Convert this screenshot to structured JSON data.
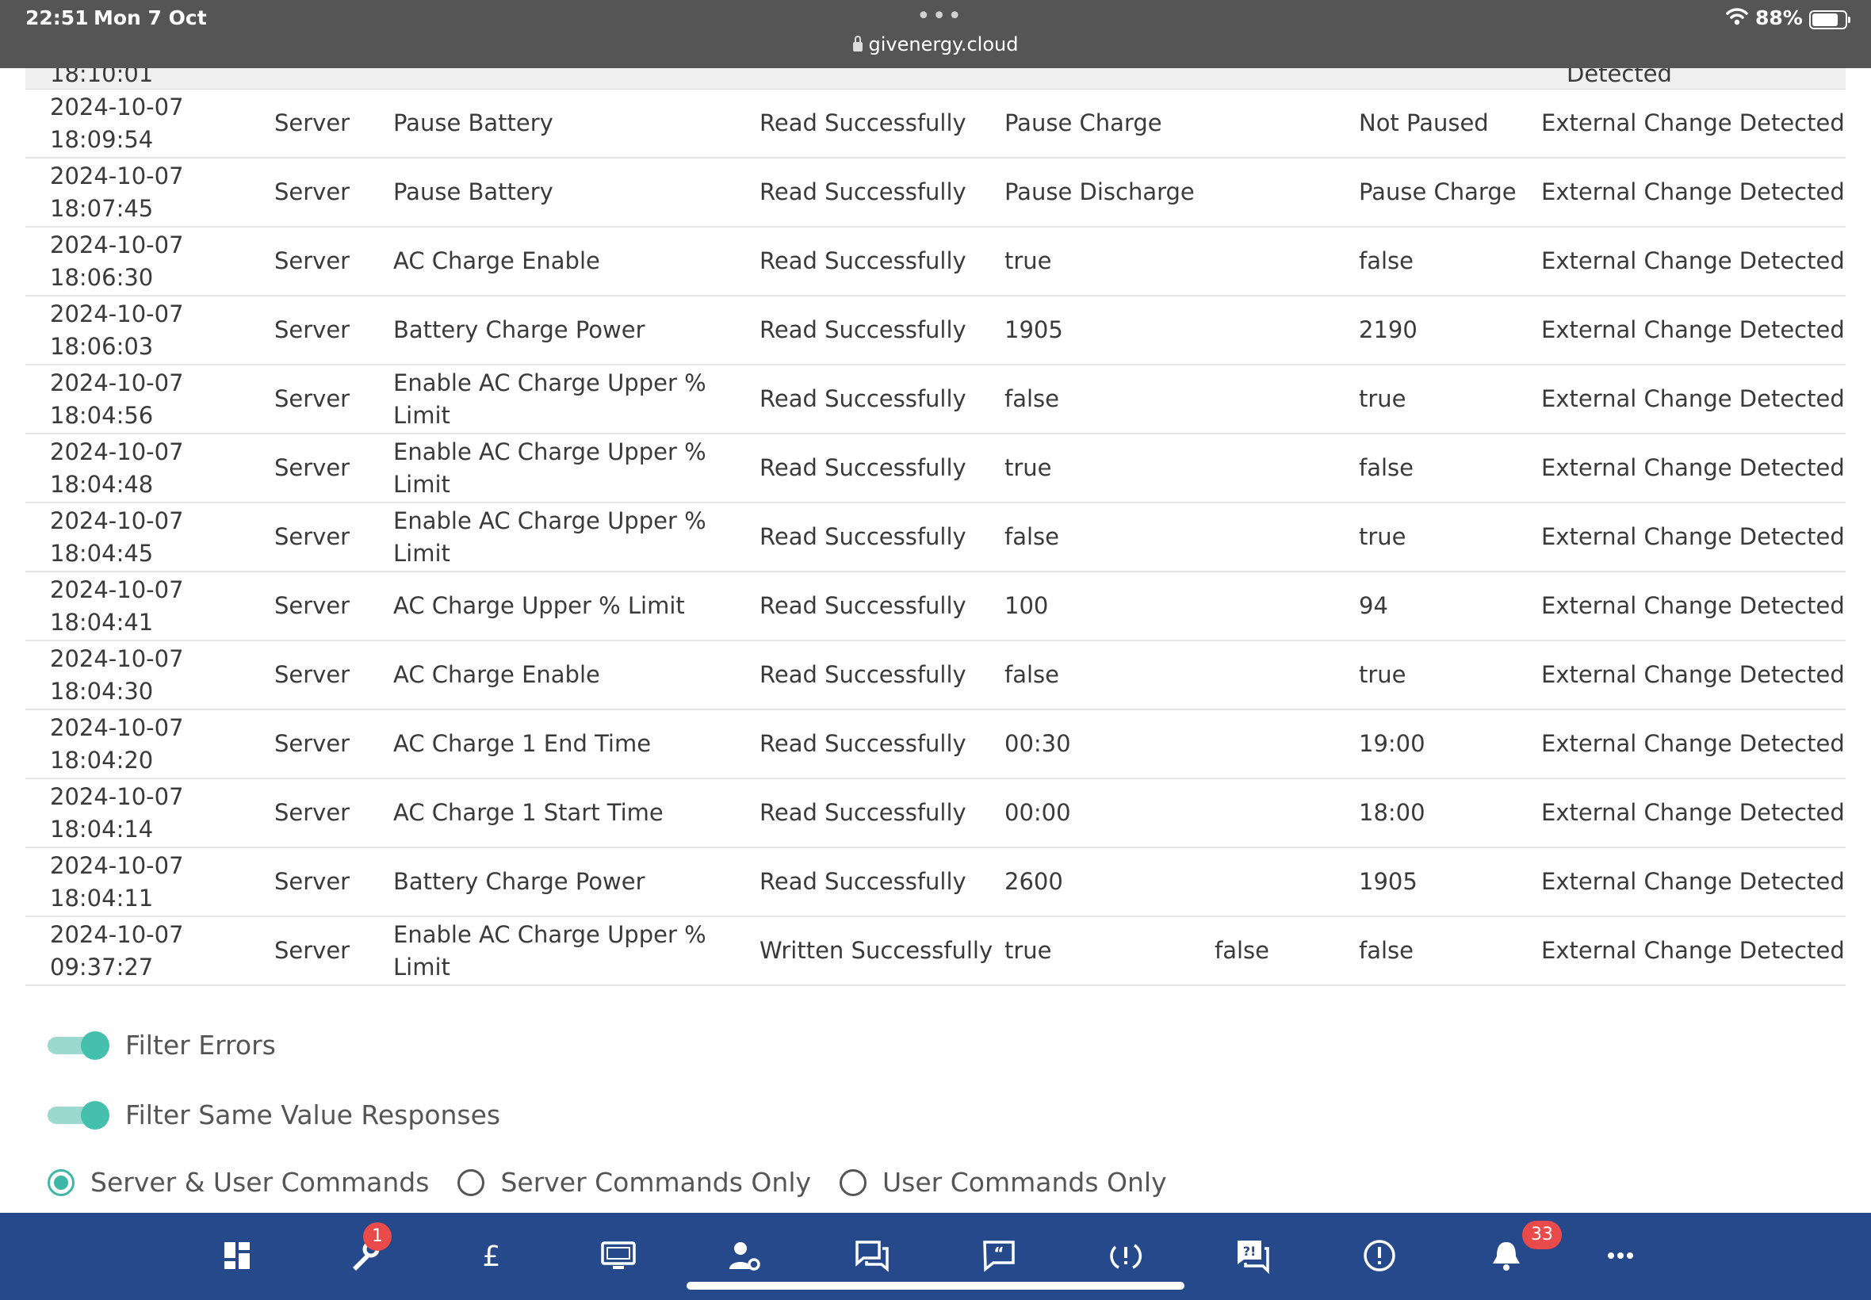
{
  "status_bar": {
    "time": "22:51",
    "date": "Mon 7 Oct",
    "url": "givenergy.cloud",
    "battery_percent": "88%",
    "battery_level": 0.88
  },
  "partial_row": {
    "timestamp": "18:10:01",
    "outcome": "Detected"
  },
  "rows": [
    {
      "date": "2024-10-07",
      "time": "18:09:54",
      "source": "Server",
      "setting": "Pause Battery",
      "status": "Read Successfully",
      "old_value": "Pause Charge",
      "requested_value": "",
      "new_value": "Not Paused",
      "outcome": "External Change Detected"
    },
    {
      "date": "2024-10-07",
      "time": "18:07:45",
      "source": "Server",
      "setting": "Pause Battery",
      "status": "Read Successfully",
      "old_value": "Pause Discharge",
      "requested_value": "",
      "new_value": "Pause Charge",
      "outcome": "External Change Detected"
    },
    {
      "date": "2024-10-07",
      "time": "18:06:30",
      "source": "Server",
      "setting": "AC Charge Enable",
      "status": "Read Successfully",
      "old_value": "true",
      "requested_value": "",
      "new_value": "false",
      "outcome": "External Change Detected"
    },
    {
      "date": "2024-10-07",
      "time": "18:06:03",
      "source": "Server",
      "setting": "Battery Charge Power",
      "status": "Read Successfully",
      "old_value": "1905",
      "requested_value": "",
      "new_value": "2190",
      "outcome": "External Change Detected"
    },
    {
      "date": "2024-10-07",
      "time": "18:04:56",
      "source": "Server",
      "setting": "Enable AC Charge Upper % Limit",
      "status": "Read Successfully",
      "old_value": "false",
      "requested_value": "",
      "new_value": "true",
      "outcome": "External Change Detected"
    },
    {
      "date": "2024-10-07",
      "time": "18:04:48",
      "source": "Server",
      "setting": "Enable AC Charge Upper % Limit",
      "status": "Read Successfully",
      "old_value": "true",
      "requested_value": "",
      "new_value": "false",
      "outcome": "External Change Detected"
    },
    {
      "date": "2024-10-07",
      "time": "18:04:45",
      "source": "Server",
      "setting": "Enable AC Charge Upper % Limit",
      "status": "Read Successfully",
      "old_value": "false",
      "requested_value": "",
      "new_value": "true",
      "outcome": "External Change Detected"
    },
    {
      "date": "2024-10-07",
      "time": "18:04:41",
      "source": "Server",
      "setting": "AC Charge Upper % Limit",
      "status": "Read Successfully",
      "old_value": "100",
      "requested_value": "",
      "new_value": "94",
      "outcome": "External Change Detected"
    },
    {
      "date": "2024-10-07",
      "time": "18:04:30",
      "source": "Server",
      "setting": "AC Charge Enable",
      "status": "Read Successfully",
      "old_value": "false",
      "requested_value": "",
      "new_value": "true",
      "outcome": "External Change Detected"
    },
    {
      "date": "2024-10-07",
      "time": "18:04:20",
      "source": "Server",
      "setting": "AC Charge 1 End Time",
      "status": "Read Successfully",
      "old_value": "00:30",
      "requested_value": "",
      "new_value": "19:00",
      "outcome": "External Change Detected"
    },
    {
      "date": "2024-10-07",
      "time": "18:04:14",
      "source": "Server",
      "setting": "AC Charge 1 Start Time",
      "status": "Read Successfully",
      "old_value": "00:00",
      "requested_value": "",
      "new_value": "18:00",
      "outcome": "External Change Detected"
    },
    {
      "date": "2024-10-07",
      "time": "18:04:11",
      "source": "Server",
      "setting": "Battery Charge Power",
      "status": "Read Successfully",
      "old_value": "2600",
      "requested_value": "",
      "new_value": "1905",
      "outcome": "External Change Detected"
    },
    {
      "date": "2024-10-07",
      "time": "09:37:27",
      "source": "Server",
      "setting": "Enable AC Charge Upper % Limit",
      "status": "Written Successfully",
      "old_value": "true",
      "requested_value": "false",
      "new_value": "false",
      "outcome": "External Change Detected"
    }
  ],
  "filters": {
    "filter_errors": {
      "label": "Filter Errors",
      "on": true
    },
    "filter_same_value": {
      "label": "Filter Same Value Responses",
      "on": true
    }
  },
  "command_filter": {
    "options": [
      "Server & User Commands",
      "Server Commands Only",
      "User Commands Only"
    ],
    "selected": "Server & User Commands"
  },
  "bottom_nav": {
    "items": [
      {
        "icon": "dashboard-icon"
      },
      {
        "icon": "wrench-icon",
        "badge": "1"
      },
      {
        "icon": "pound-icon"
      },
      {
        "icon": "monitor-icon"
      },
      {
        "icon": "user-settings-icon"
      },
      {
        "icon": "chat-icon"
      },
      {
        "icon": "quote-message-icon"
      },
      {
        "icon": "sync-alert-icon"
      },
      {
        "icon": "faq-icon"
      },
      {
        "icon": "alert-circle-icon"
      },
      {
        "icon": "bell-icon",
        "badge": "33"
      },
      {
        "icon": "more-icon"
      }
    ]
  },
  "colors": {
    "status_bar": "#555555",
    "nav_background": "#25498a",
    "accent_teal": "#45bfae",
    "badge_red": "#e94b4b"
  }
}
